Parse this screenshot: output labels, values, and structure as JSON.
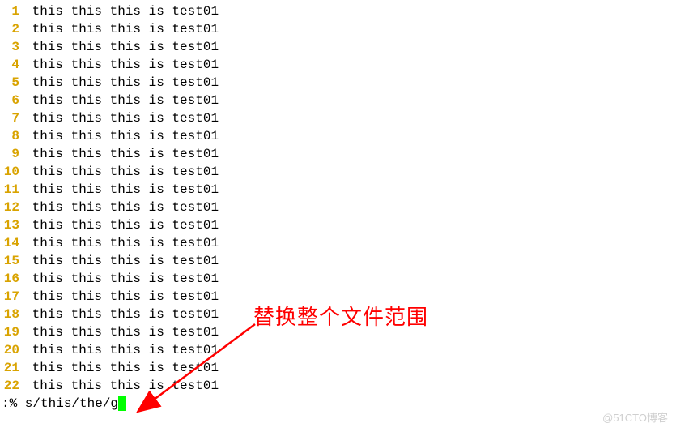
{
  "editor": {
    "lines": [
      {
        "n": "1",
        "text": "this this this is test01"
      },
      {
        "n": "2",
        "text": "this this this is test01"
      },
      {
        "n": "3",
        "text": "this this this is test01"
      },
      {
        "n": "4",
        "text": "this this this is test01"
      },
      {
        "n": "5",
        "text": "this this this is test01"
      },
      {
        "n": "6",
        "text": "this this this is test01"
      },
      {
        "n": "7",
        "text": "this this this is test01"
      },
      {
        "n": "8",
        "text": "this this this is test01"
      },
      {
        "n": "9",
        "text": "this this this is test01"
      },
      {
        "n": "10",
        "text": "this this this is test01"
      },
      {
        "n": "11",
        "text": "this this this is test01"
      },
      {
        "n": "12",
        "text": "this this this is test01"
      },
      {
        "n": "13",
        "text": "this this this is test01"
      },
      {
        "n": "14",
        "text": "this this this is test01"
      },
      {
        "n": "15",
        "text": "this this this is test01"
      },
      {
        "n": "16",
        "text": "this this this is test01"
      },
      {
        "n": "17",
        "text": "this this this is test01"
      },
      {
        "n": "18",
        "text": "this this this is test01"
      },
      {
        "n": "19",
        "text": "this this this is test01"
      },
      {
        "n": "20",
        "text": "this this this is test01"
      },
      {
        "n": "21",
        "text": "this this this is test01"
      },
      {
        "n": "22",
        "text": "this this this is test01"
      }
    ],
    "command": ":% s/this/the/g"
  },
  "annotation": {
    "text": "替换整个文件范围",
    "arrow_color": "#ff0000"
  },
  "watermark": "@51CTO博客"
}
